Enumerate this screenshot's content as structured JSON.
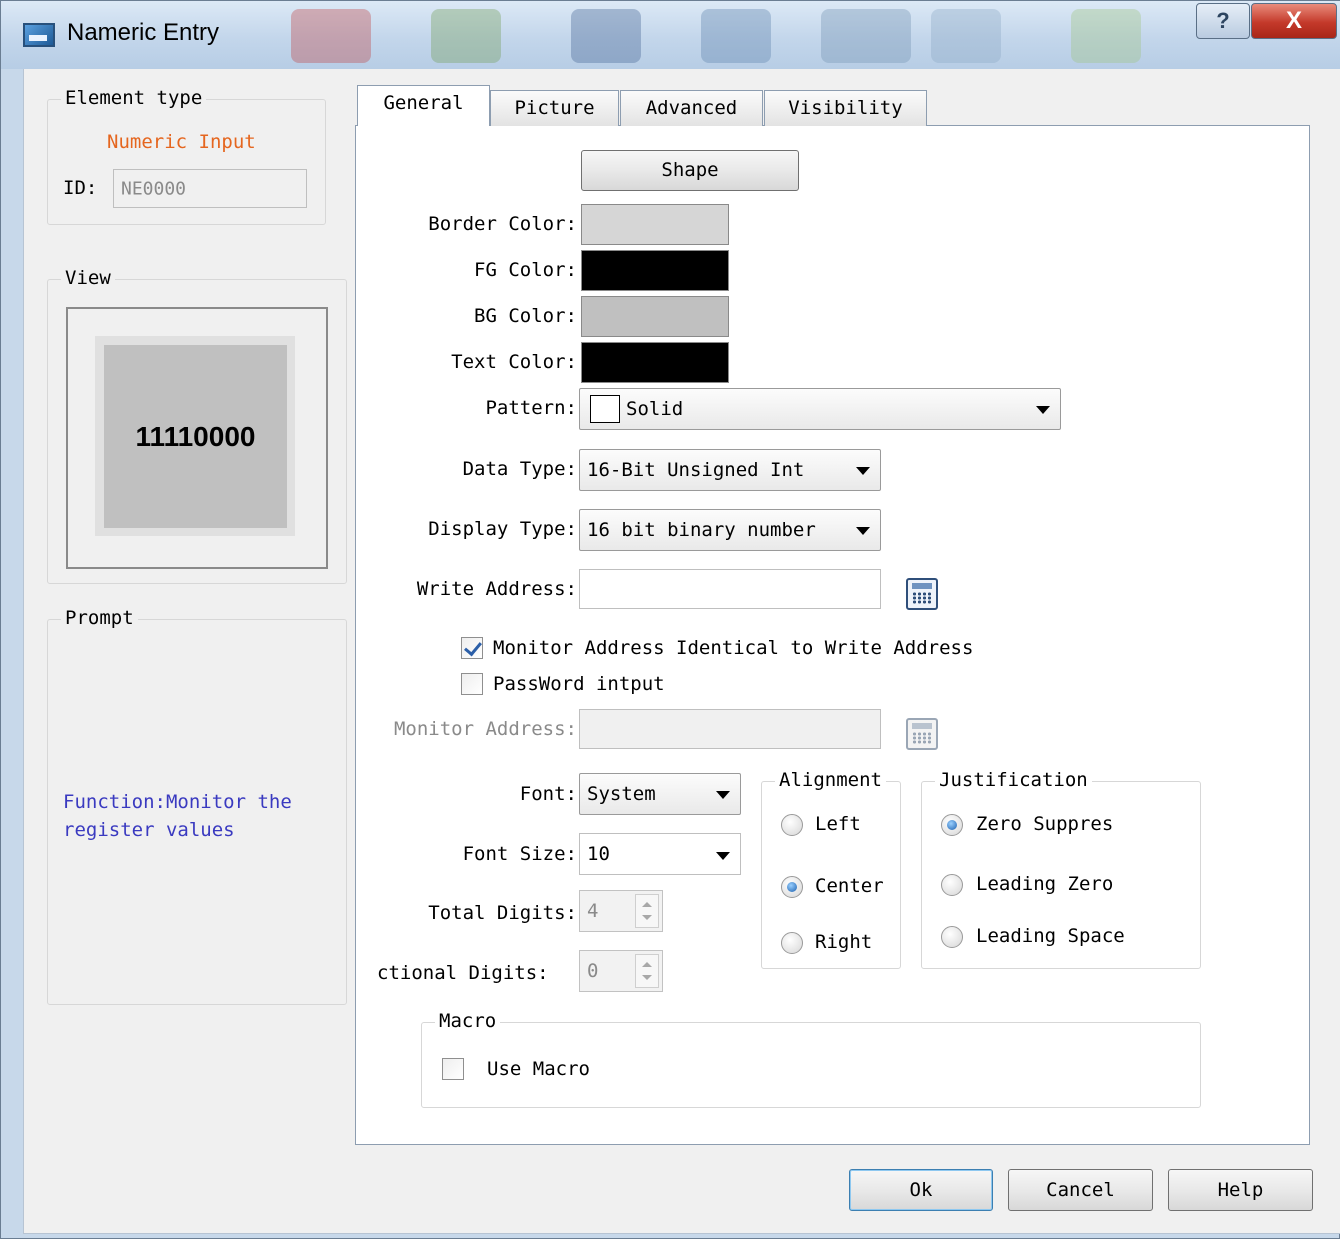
{
  "window": {
    "title": "Nameric Entry",
    "help_glyph": "?",
    "close_glyph": "X"
  },
  "element_type": {
    "group_label": "Element type",
    "type_name": "Numeric Input",
    "type_color": "#e5661f",
    "id_label": "ID:",
    "id_value": "NE0000"
  },
  "view": {
    "group_label": "View",
    "preview_value": "11110000"
  },
  "prompt": {
    "group_label": "Prompt",
    "text_line1": "Function:Monitor the",
    "text_line2": "register values",
    "text_color": "#3a3ac0"
  },
  "tabs": [
    {
      "label": "General",
      "active": true
    },
    {
      "label": "Picture",
      "active": false
    },
    {
      "label": "Advanced",
      "active": false
    },
    {
      "label": "Visibility",
      "active": false
    }
  ],
  "general": {
    "shape_button": "Shape",
    "border_color_label": "Border Color:",
    "fg_color_label": "FG Color:",
    "bg_color_label": "BG Color:",
    "text_color_label": "Text Color:",
    "colors": {
      "border": "#d6d6d6",
      "fg": "#000000",
      "bg": "#c0c0c0",
      "text": "#000000"
    },
    "pattern_label": "Pattern:",
    "pattern_value": "Solid",
    "data_type_label": "Data Type:",
    "data_type_value": "16-Bit Unsigned Int",
    "display_type_label": "Display Type:",
    "display_type_value": "16 bit binary number",
    "write_address_label": "Write Address:",
    "write_address_value": "",
    "monitor_identical_label": "Monitor Address Identical to Write Address",
    "monitor_identical_checked": true,
    "password_label": "PassWord intput",
    "password_checked": false,
    "monitor_address_label": "Monitor Address:",
    "monitor_address_value": "",
    "font_label": "Font:",
    "font_value": "System",
    "font_size_label": "Font Size:",
    "font_size_value": "10",
    "total_digits_label": "Total Digits:",
    "total_digits_value": "4",
    "fractional_digits_label": "ctional Digits:",
    "fractional_digits_value": "0"
  },
  "alignment": {
    "group_label": "Alignment",
    "options": [
      {
        "label": "Left",
        "selected": false
      },
      {
        "label": "Center",
        "selected": true
      },
      {
        "label": "Right",
        "selected": false
      }
    ]
  },
  "justification": {
    "group_label": "Justification",
    "options": [
      {
        "label": "Zero Suppres",
        "selected": true
      },
      {
        "label": "Leading Zero",
        "selected": false
      },
      {
        "label": "Leading Space",
        "selected": false
      }
    ]
  },
  "macro": {
    "group_label": "Macro",
    "use_macro_label": "Use Macro",
    "use_macro_checked": false
  },
  "footer": {
    "ok": "Ok",
    "cancel": "Cancel",
    "help": "Help"
  }
}
